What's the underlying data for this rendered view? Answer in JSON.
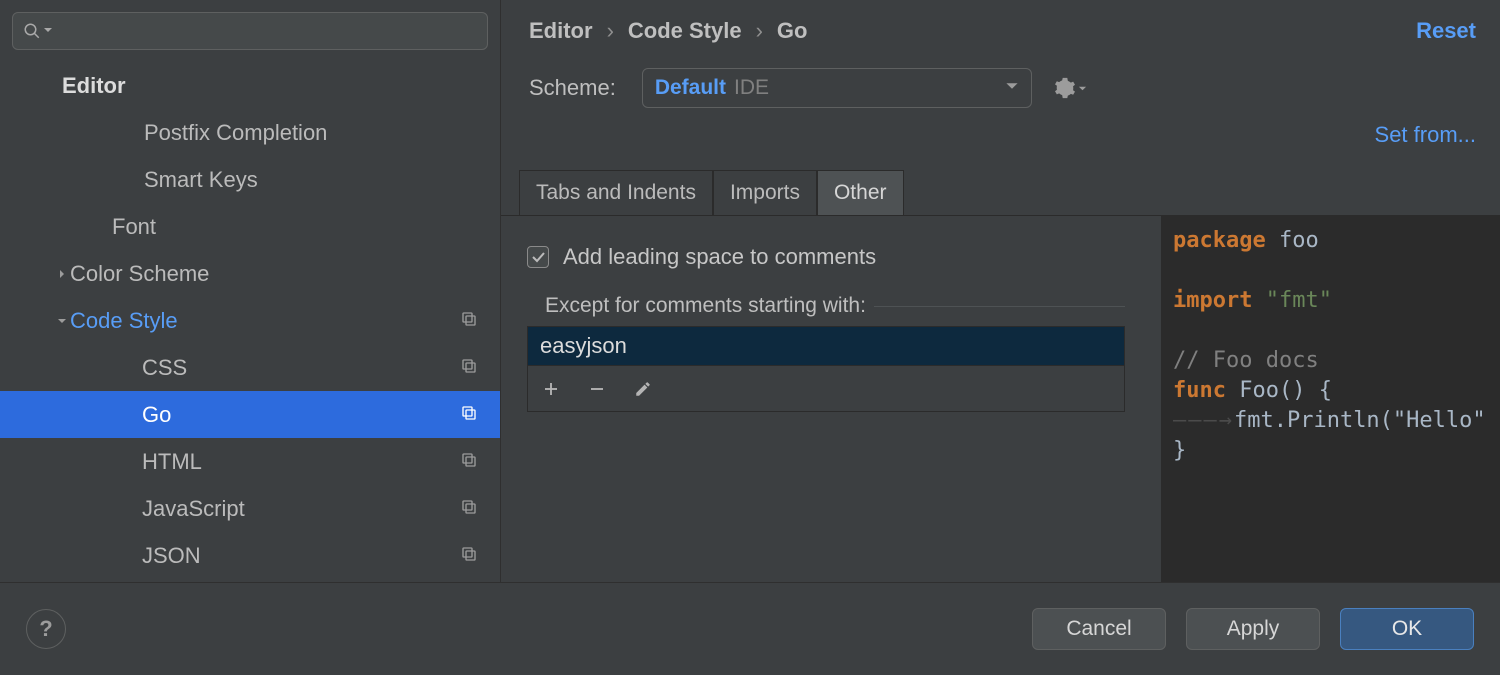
{
  "sidebar": {
    "header": "Editor",
    "items": [
      {
        "label": "Postfix Completion",
        "level": "pad1",
        "chev": "",
        "icon": false
      },
      {
        "label": "Smart Keys",
        "level": "pad1",
        "chev": "",
        "icon": false
      },
      {
        "label": "Font",
        "level": "pad2",
        "chev": "",
        "icon": false
      },
      {
        "label": "Color Scheme",
        "level": "pad2b",
        "chev": "right",
        "icon": false
      },
      {
        "label": "Code Style",
        "level": "pad2b",
        "chev": "down",
        "icon": true,
        "class": "highlight"
      },
      {
        "label": "CSS",
        "level": "pad3",
        "chev": "",
        "icon": true
      },
      {
        "label": "Go",
        "level": "pad3",
        "chev": "",
        "icon": true,
        "class": "selected"
      },
      {
        "label": "HTML",
        "level": "pad3",
        "chev": "",
        "icon": true
      },
      {
        "label": "JavaScript",
        "level": "pad3",
        "chev": "",
        "icon": true
      },
      {
        "label": "JSON",
        "level": "pad3",
        "chev": "",
        "icon": true
      }
    ]
  },
  "breadcrumb": [
    "Editor",
    "Code Style",
    "Go"
  ],
  "reset": "Reset",
  "scheme": {
    "label": "Scheme:",
    "name": "Default",
    "tag": "IDE"
  },
  "setfrom": "Set from...",
  "tabs": [
    "Tabs and Indents",
    "Imports",
    "Other"
  ],
  "active_tab": 2,
  "checkbox": {
    "label": "Add leading space to comments",
    "checked": true
  },
  "except_label": "Except for comments starting with:",
  "except_items": [
    "easyjson"
  ],
  "preview": {
    "l1a": "package",
    "l1b": " foo",
    "l2a": "import",
    "l2b": " \"fmt\"",
    "l3": "// Foo docs",
    "l4a": "func",
    "l4b": " Foo() {",
    "l5pre": "———→",
    "l5": "fmt.Println(\"Hello\"",
    "l6": "}"
  },
  "buttons": {
    "help": "?",
    "cancel": "Cancel",
    "apply": "Apply",
    "ok": "OK"
  }
}
